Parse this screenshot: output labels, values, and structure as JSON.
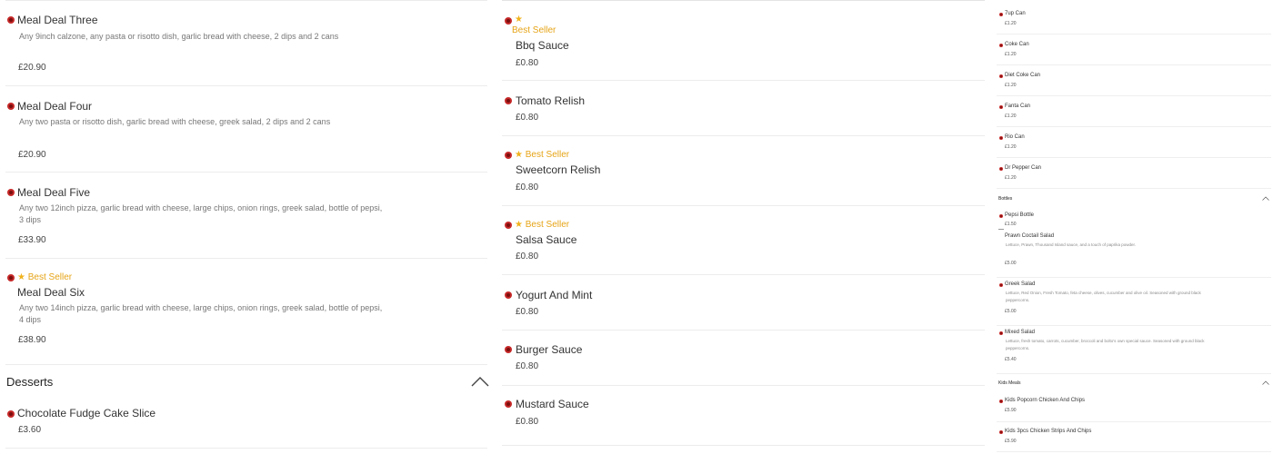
{
  "left_column": {
    "items": [
      {
        "name": "Meal Deal Three",
        "description": "Any 9inch calzone, any pasta or risotto dish, garlic bread with cheese, 2 dips and 2 cans",
        "price": "£20.90"
      },
      {
        "name": "Meal Deal Four",
        "description": "Any two pasta or risotto dish, garlic bread with cheese, greek salad, 2 dips and 2 cans",
        "price": "£20.90"
      },
      {
        "name": "Meal Deal Five",
        "description": "Any two 12inch pizza, garlic bread with cheese, large chips, onion rings, greek salad, bottle of pepsi, 3 dips",
        "price": "£33.90"
      },
      {
        "name": "Meal Deal Six",
        "badge": "Best Seller",
        "description": "Any two 14inch pizza, garlic bread with cheese, large chips, onion rings, greek salad, bottle of pepsi, 4 dips",
        "price": "£38.90"
      }
    ],
    "section": {
      "title": "Desserts"
    },
    "section_items": [
      {
        "name": "Chocolate Fudge Cake Slice",
        "price": "£3.60"
      }
    ]
  },
  "middle_column": {
    "items": [
      {
        "name": "Bbq Sauce",
        "badge": "Best Seller",
        "price": "£0.80"
      },
      {
        "name": "Tomato Relish",
        "price": "£0.80"
      },
      {
        "name": "Sweetcorn Relish",
        "badge": "Best Seller",
        "price": "£0.80"
      },
      {
        "name": "Salsa Sauce",
        "badge": "Best Seller",
        "price": "£0.80"
      },
      {
        "name": "Yogurt And Mint",
        "price": "£0.80"
      },
      {
        "name": "Burger Sauce",
        "price": "£0.80"
      },
      {
        "name": "Mustard Sauce",
        "price": "£0.80"
      }
    ]
  },
  "right_column": {
    "cans": [
      {
        "name": "7up Can",
        "price": "£1.20"
      },
      {
        "name": "Coke Can",
        "price": "£1.20"
      },
      {
        "name": "Diet Coke Can",
        "price": "£1.20"
      },
      {
        "name": "Fanta Can",
        "price": "£1.20"
      },
      {
        "name": "Rio Can",
        "price": "£1.20"
      },
      {
        "name": "Dr Pepper Can",
        "price": "£1.20"
      }
    ],
    "bottles_section": {
      "title": "Bottles"
    },
    "bottles": [
      {
        "name": "Pepsi Bottle",
        "price": "£1.50"
      }
    ],
    "salads": [
      {
        "name": "Prawn Coctail Salad",
        "description": "Lettuce, Prawn, Thousand Island sauce, and a touch of paprika powder.",
        "price": "£5.00"
      },
      {
        "name": "Greek Salad",
        "description": "Lettuce, Red Onion, Fresh Tomato, feta cheese, olives, cucumber and olive oil. Seasoned with ground black peppercorns.",
        "price": "£5.00"
      },
      {
        "name": "Mixed Salad",
        "description": "Lettuce, fresh tomato, carrots, cucumber, broccoli and bolto's own special sauce. Seasoned with ground black peppercorns.",
        "price": "£5.40"
      }
    ],
    "kids_section": {
      "title": "Kids Meals"
    },
    "kids": [
      {
        "name": "Kids Popcorn Chicken And Chips",
        "price": "£5.90"
      },
      {
        "name": "Kids 3pcs Chicken Strips And Chips",
        "price": "£5.90"
      }
    ]
  },
  "icons": {
    "veg_dot": "red-dot-icon",
    "star": "star-icon",
    "collapse": "chevron-up-icon"
  },
  "colors": {
    "accent_red": "#c62828",
    "best_seller": "#e6a417",
    "divider": "#ececec"
  }
}
